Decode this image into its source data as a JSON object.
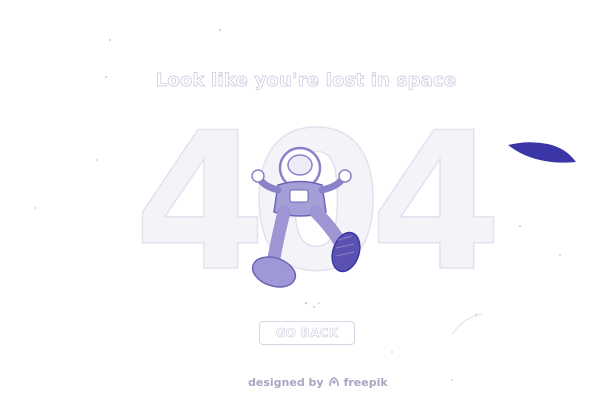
{
  "headline": "Look like you're lost in space",
  "error_code": [
    "4",
    "0",
    "4"
  ],
  "go_back_label": "GO BACK",
  "credit": {
    "designed_by": "designed by",
    "brand": "freepik"
  },
  "colors": {
    "accent": "#3b36a8",
    "astronaut": "#8a82c9",
    "outline": "#e3e1ee"
  },
  "icons": {
    "credit_logo": "freepik-logo-icon"
  }
}
